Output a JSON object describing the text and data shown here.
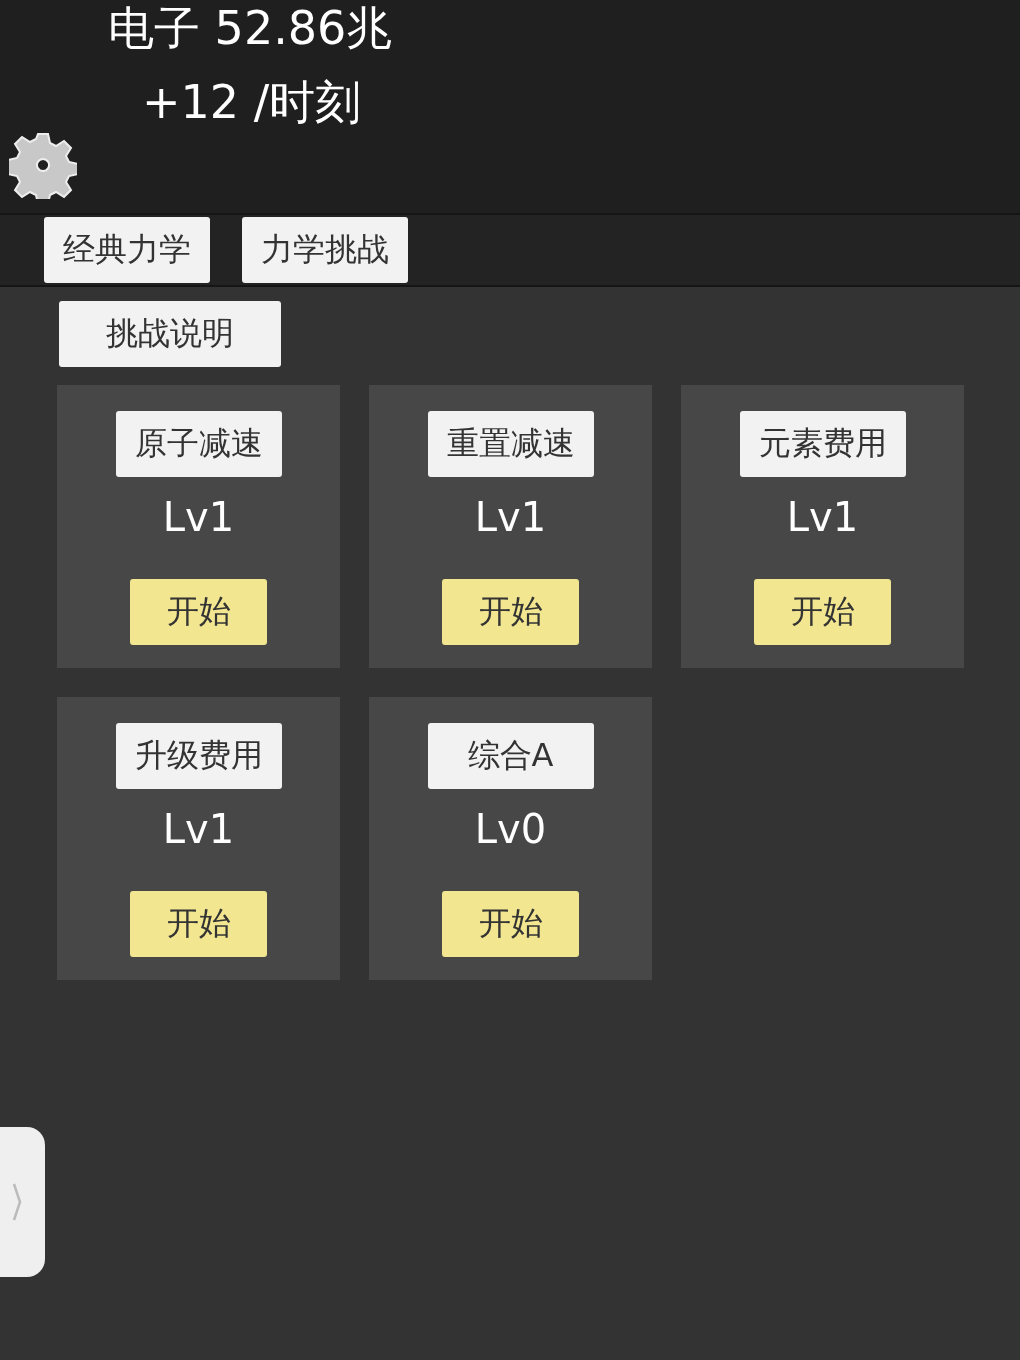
{
  "header": {
    "resource": "电子 52.86兆",
    "rate": "+12 /时刻"
  },
  "tabs": [
    {
      "label": "经典力学"
    },
    {
      "label": "力学挑战"
    }
  ],
  "info_button": "挑战说明",
  "challenges": [
    {
      "name": "原子减速",
      "level": "Lv1",
      "action": "开始"
    },
    {
      "name": "重置减速",
      "level": "Lv1",
      "action": "开始"
    },
    {
      "name": "元素费用",
      "level": "Lv1",
      "action": "开始"
    },
    {
      "name": "升级费用",
      "level": "Lv1",
      "action": "开始"
    },
    {
      "name": "综合A",
      "level": "Lv0",
      "action": "开始"
    }
  ]
}
